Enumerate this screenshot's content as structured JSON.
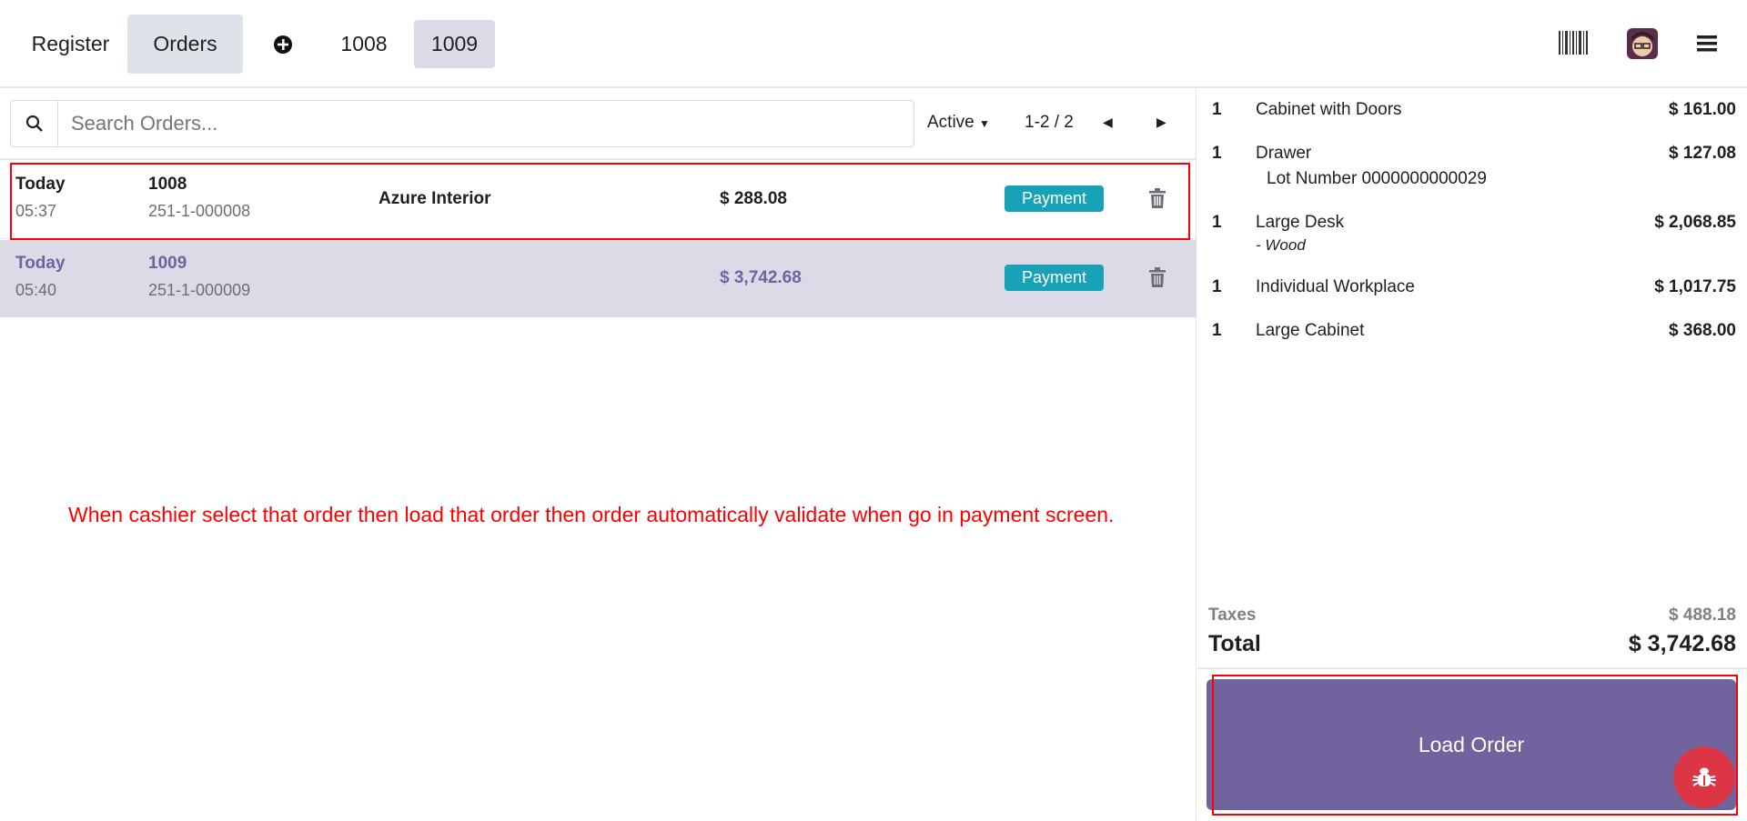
{
  "header": {
    "tabs": [
      {
        "label": "Register"
      },
      {
        "label": "Orders"
      },
      {
        "label": "1008"
      },
      {
        "label": "1009"
      }
    ],
    "icons": [
      "plus-circle-icon",
      "barcode-icon",
      "avatar",
      "hamburger-menu-icon"
    ]
  },
  "search": {
    "placeholder": "Search Orders...",
    "value": "",
    "filter": "Active",
    "pagination": "1-2 / 2"
  },
  "orders": [
    {
      "date": "Today",
      "time": "05:37",
      "number": "1008",
      "ref": "251-1-000008",
      "customer": "Azure Interior",
      "total": "$ 288.08",
      "status": "Payment"
    },
    {
      "date": "Today",
      "time": "05:40",
      "number": "1009",
      "ref": "251-1-000009",
      "customer": "",
      "total": "$ 3,742.68",
      "status": "Payment"
    }
  ],
  "annotation": "When cashier select that order then load that order then order automatically validate when go in payment screen.",
  "order_lines": [
    {
      "qty": "1",
      "name": "Cabinet with Doors",
      "price": "$ 161.00",
      "note": ""
    },
    {
      "qty": "1",
      "name": "Drawer",
      "price": "$ 127.08",
      "note": "Lot Number 0000000000029"
    },
    {
      "qty": "1",
      "name": "Large Desk",
      "price": "$ 2,068.85",
      "note": "- Wood"
    },
    {
      "qty": "1",
      "name": "Individual Workplace",
      "price": "$ 1,017.75",
      "note": ""
    },
    {
      "qty": "1",
      "name": "Large Cabinet",
      "price": "$ 368.00",
      "note": ""
    }
  ],
  "summary": {
    "taxes_label": "Taxes",
    "taxes": "$ 488.18",
    "total_label": "Total",
    "total": "$ 3,742.68"
  },
  "load_button": "Load Order",
  "colors": {
    "accent": "#71639e",
    "badge": "#17a2b8",
    "annotation": "#ff0000",
    "debug": "#dc3545"
  }
}
